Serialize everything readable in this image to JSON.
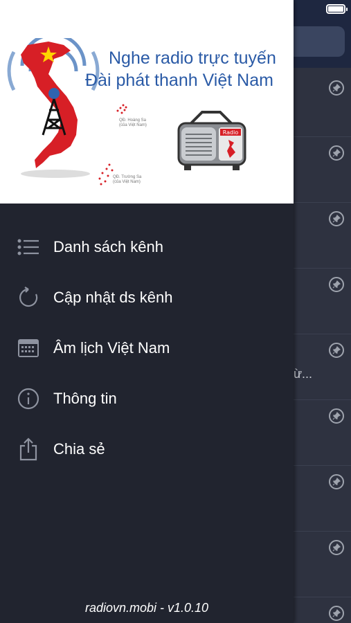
{
  "banner": {
    "title_line1": "Nghe radio trực tuyến",
    "title_line2": "Đài phát thanh Việt Nam",
    "island1_line1": "QĐ. Hoàng Sa",
    "island1_line2": "(của Việt Nam)",
    "island2_line1": "QĐ. Trường Sa",
    "island2_line2": "(của Việt Nam)",
    "radio_badge": "Radio"
  },
  "menu": {
    "items": [
      {
        "label": "Danh sách kênh",
        "icon": "list-icon"
      },
      {
        "label": "Cập nhật ds kênh",
        "icon": "refresh-icon"
      },
      {
        "label": "Âm lịch Việt Nam",
        "icon": "calendar-icon"
      },
      {
        "label": "Thông tin",
        "icon": "info-icon"
      },
      {
        "label": "Chia sẻ",
        "icon": "share-icon"
      }
    ]
  },
  "footer": {
    "text": "radiovn.mobi - v1.0.10"
  },
  "background": {
    "snippet": "ừ..."
  },
  "colors": {
    "drawer_bg": "#21242f",
    "title_blue": "#2a5aa6",
    "icon_gray": "#8e93a0",
    "flag_red": "#d71f26"
  }
}
